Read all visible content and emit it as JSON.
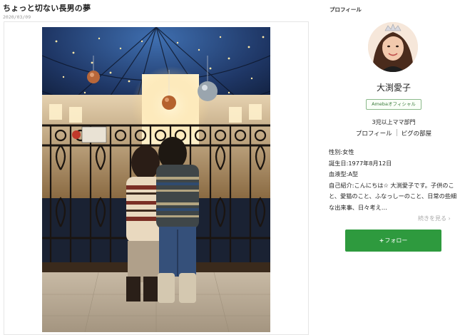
{
  "post": {
    "title": "ちょっと切ない長男の夢",
    "date": "2020/03/09"
  },
  "sidebar": {
    "heading": "プロフィール",
    "name": "大渕愛子",
    "badge": "Amebaオフィシャル",
    "rank": "3児以上ママ部門",
    "links": [
      "プロフィール",
      "ピグの部屋"
    ],
    "info": {
      "gender": "性別:女性",
      "birthday": "誕生日:1977年8月12日",
      "blood": "血液型:A型",
      "intro": "自己紹介:こんにちは☆ 大渕愛子です。子供のこと、愛猫のこと、ふなっしーのこと、日常の些細な出来事、日々考え…"
    },
    "more": "続きを見る",
    "follow": "フォロー"
  },
  "icons": {
    "more_arrow": "chevron-right-icon",
    "follow_plus": "plus-icon"
  },
  "colors": {
    "accent_green": "#2e9a3e",
    "badge_border": "#8bb98b"
  }
}
